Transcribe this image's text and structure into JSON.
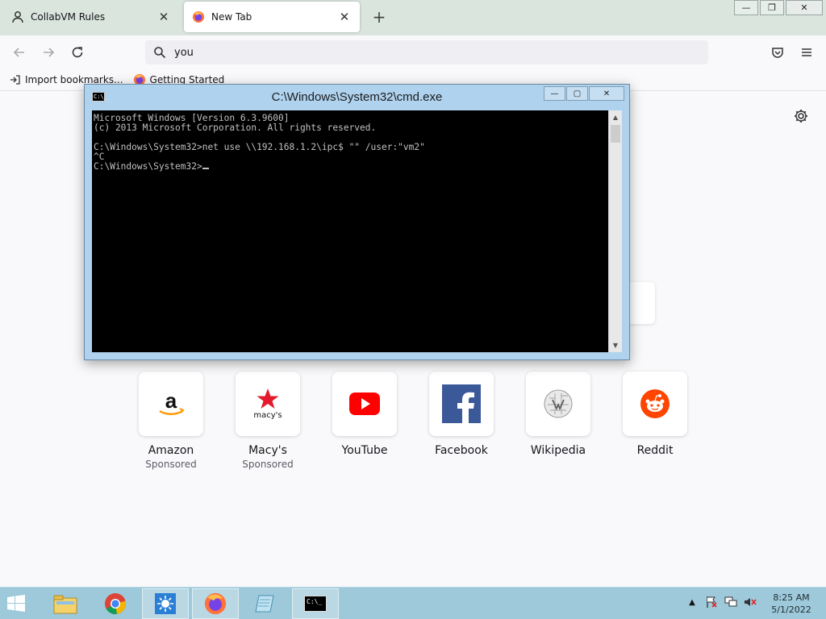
{
  "browser": {
    "tabs": [
      {
        "label": "CollabVM Rules",
        "icon": "person-icon",
        "active": false
      },
      {
        "label": "New Tab",
        "icon": "firefox-icon",
        "active": true
      }
    ],
    "close_glyph": "✕",
    "new_tab_glyph": "+",
    "window_controls": {
      "minimize": "—",
      "restore": "❐",
      "close": "✕"
    },
    "url_value": "you",
    "bookmarks": [
      {
        "label": "Import bookmarks...",
        "icon": "import-icon"
      },
      {
        "label": "Getting Started",
        "icon": "firefox-icon"
      }
    ]
  },
  "cmd": {
    "title": "C:\\Windows\\System32\\cmd.exe",
    "icon_text": "C:\\_",
    "lines": [
      "Microsoft Windows [Version 6.3.9600]",
      "(c) 2013 Microsoft Corporation. All rights reserved.",
      "",
      "C:\\Windows\\System32>net use \\\\192.168.1.2\\ipc$ \"\" /user:\"vm2\"",
      "^C",
      "C:\\Windows\\System32>"
    ],
    "controls": {
      "minimize": "—",
      "maximize": "▢",
      "close": "✕"
    }
  },
  "top_sites": [
    {
      "label": "Amazon",
      "sub": "Sponsored",
      "icon": "amazon-icon"
    },
    {
      "label": "Macy's",
      "sub": "Sponsored",
      "icon": "macys-icon"
    },
    {
      "label": "YouTube",
      "sub": "",
      "icon": "youtube-icon"
    },
    {
      "label": "Facebook",
      "sub": "",
      "icon": "facebook-icon"
    },
    {
      "label": "Wikipedia",
      "sub": "",
      "icon": "wikipedia-icon"
    },
    {
      "label": "Reddit",
      "sub": "",
      "icon": "reddit-icon"
    }
  ],
  "macys_logo_text": "macy's",
  "taskbar": {
    "apps": [
      "file-explorer-icon",
      "chrome-icon",
      "weather-icon",
      "firefox-icon",
      "notepad-icon",
      "cmd-icon"
    ],
    "cmd_icon_text": "C:\\_",
    "clock_time": "8:25 AM",
    "clock_date": "5/1/2022"
  },
  "colors": {
    "tabstrip": "#d9e5dd",
    "taskbar": "#9ec9da",
    "cmd_frame": "#afd2ee",
    "youtube_red": "#ff0000",
    "facebook_blue": "#3b5998",
    "reddit_orange": "#ff4500"
  }
}
